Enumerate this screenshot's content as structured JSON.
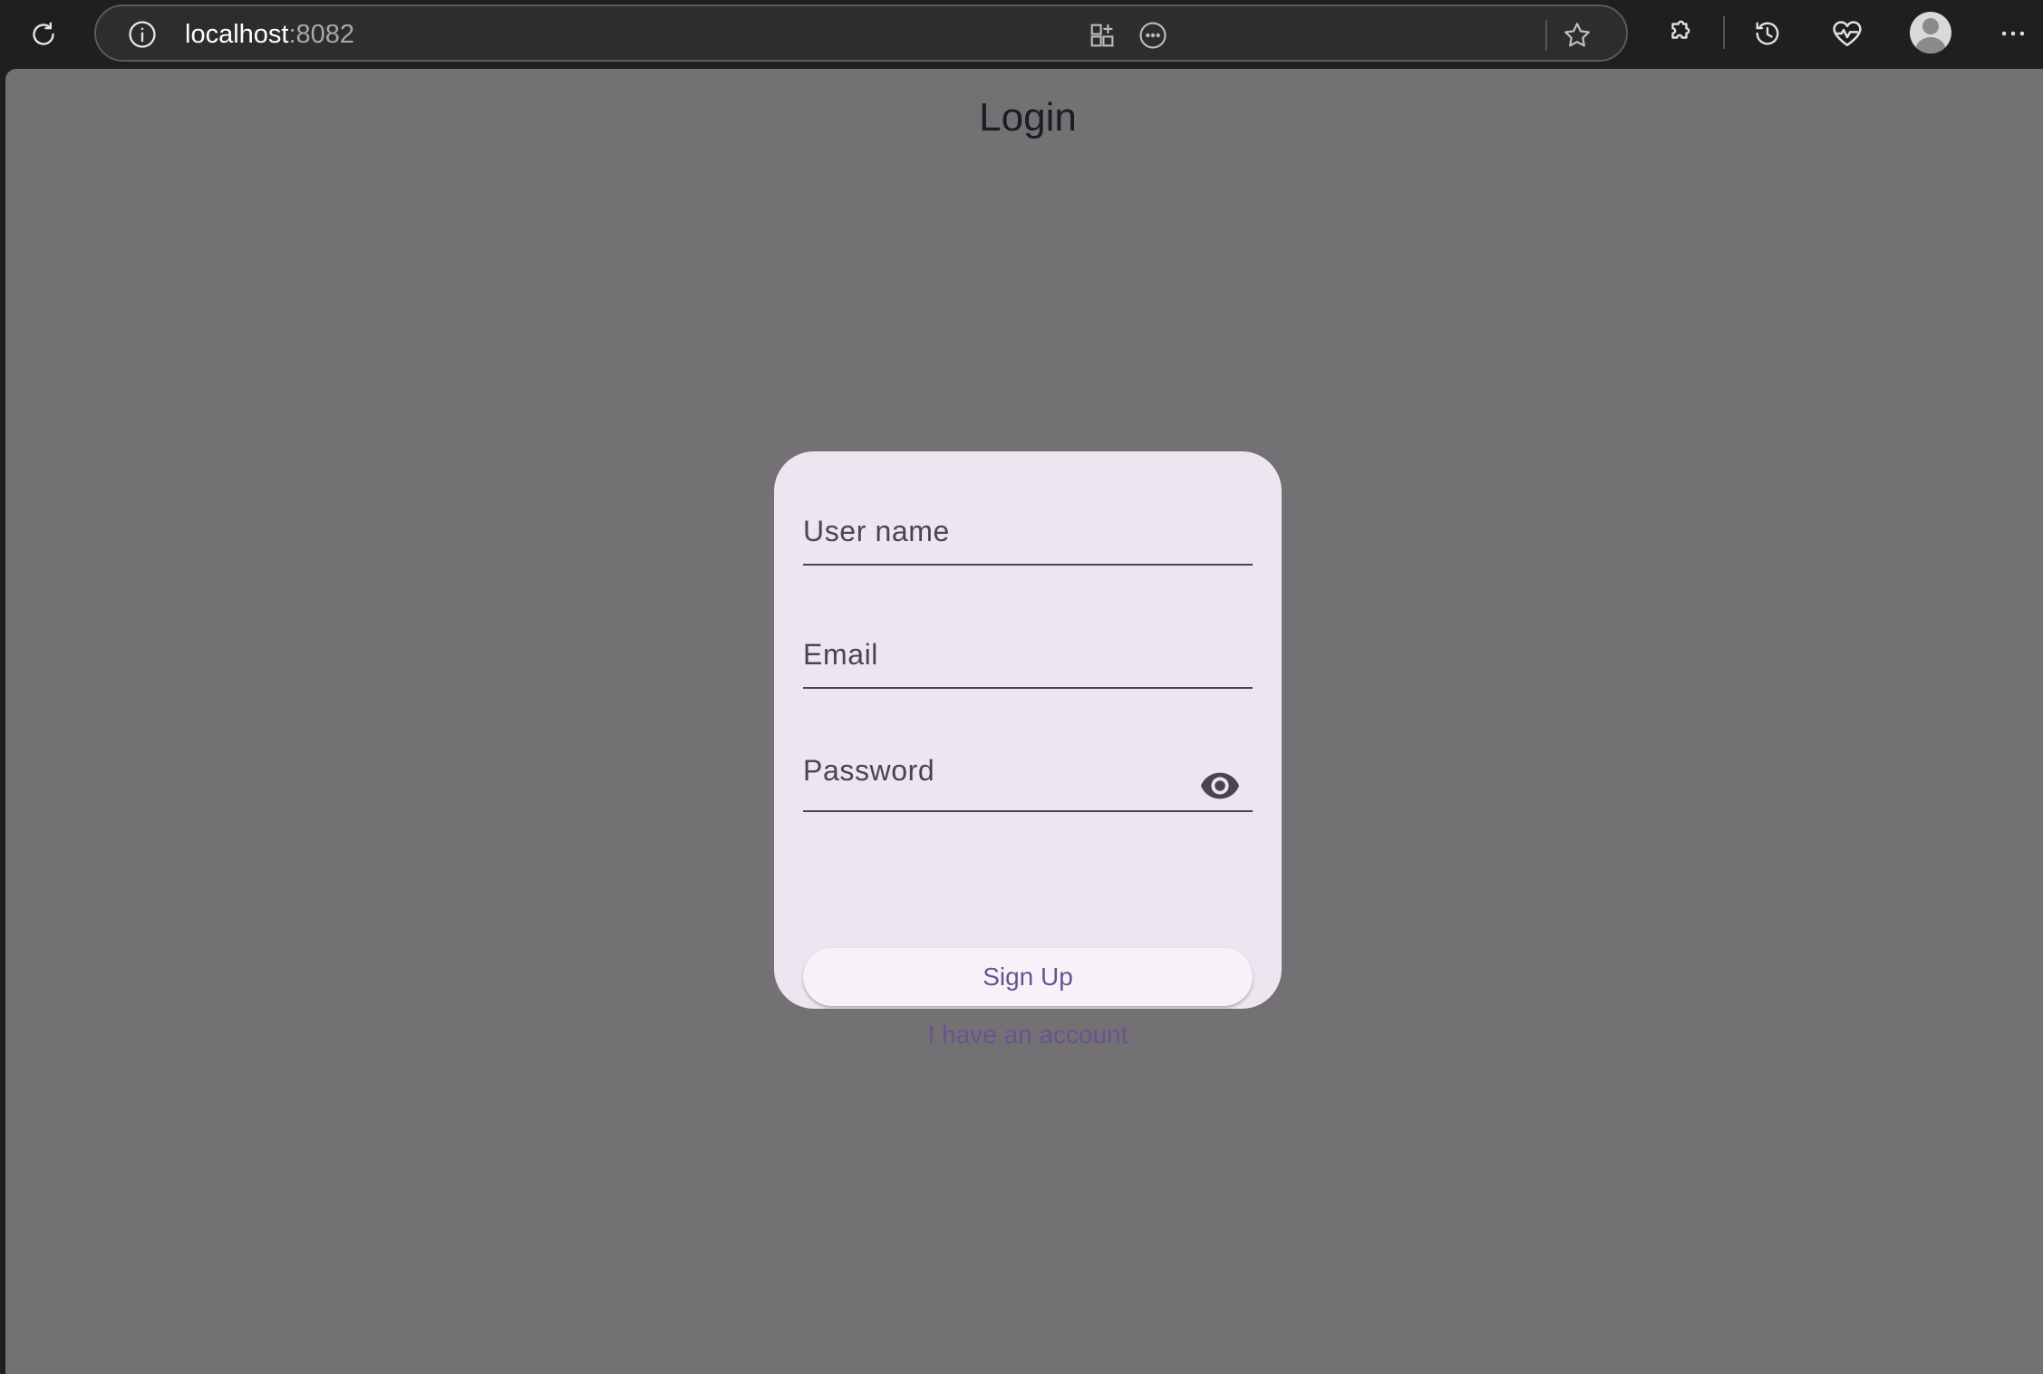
{
  "browser": {
    "url_host": "localhost",
    "url_port": ":8082",
    "icons": {
      "reload": "reload-icon",
      "site_info": "info-icon",
      "apps": "apps-icon",
      "more_page": "more-circle-icon",
      "favorite": "star-icon",
      "extensions": "puzzle-icon",
      "history": "history-icon",
      "performance": "heartbeat-icon",
      "profile": "avatar",
      "menu": "more-horizontal-icon"
    }
  },
  "page": {
    "title": "Login"
  },
  "form": {
    "username_label": "User name",
    "email_label": "Email",
    "password_label": "Password",
    "signup_label": "Sign Up",
    "account_link": "I have an account",
    "visibility_icon": "eye-icon"
  },
  "colors": {
    "page_background": "#747175",
    "card_background": "#ece6f0",
    "primary_text": "#65558f",
    "field_text": "#49454f",
    "title_text": "#1d1b20",
    "browser_chrome": "#1f1f1f"
  }
}
